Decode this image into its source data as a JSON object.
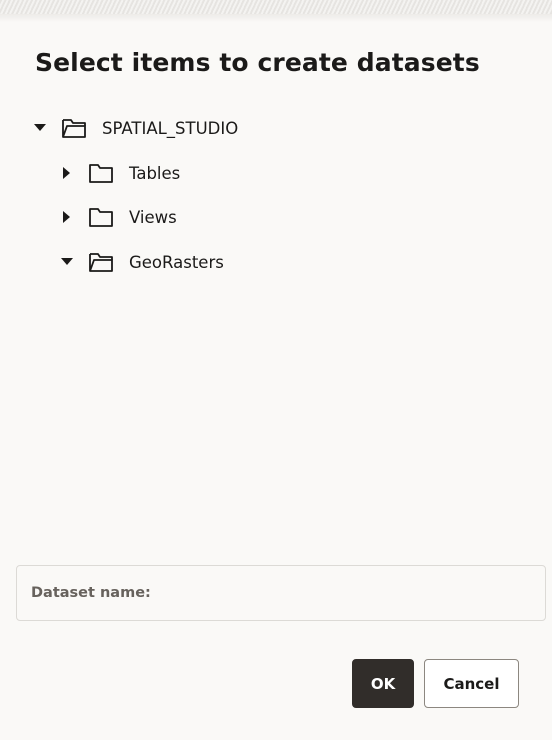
{
  "dialog": {
    "title": "Select items to create datasets"
  },
  "tree": {
    "root": {
      "label": "SPATIAL_STUDIO",
      "expanded": true,
      "icon": "folder-open-icon"
    },
    "children": [
      {
        "label": "Tables",
        "expanded": false,
        "icon": "folder-icon"
      },
      {
        "label": "Views",
        "expanded": false,
        "icon": "folder-icon"
      },
      {
        "label": "GeoRasters",
        "expanded": true,
        "icon": "folder-open-icon"
      }
    ]
  },
  "dataset": {
    "label": "Dataset name:",
    "value": ""
  },
  "buttons": {
    "ok_label": "OK",
    "cancel_label": "Cancel"
  },
  "colors": {
    "background": "#faf9f7",
    "primary_button": "#312d2a",
    "text": "#1b1a19",
    "muted_label": "#67625d"
  }
}
